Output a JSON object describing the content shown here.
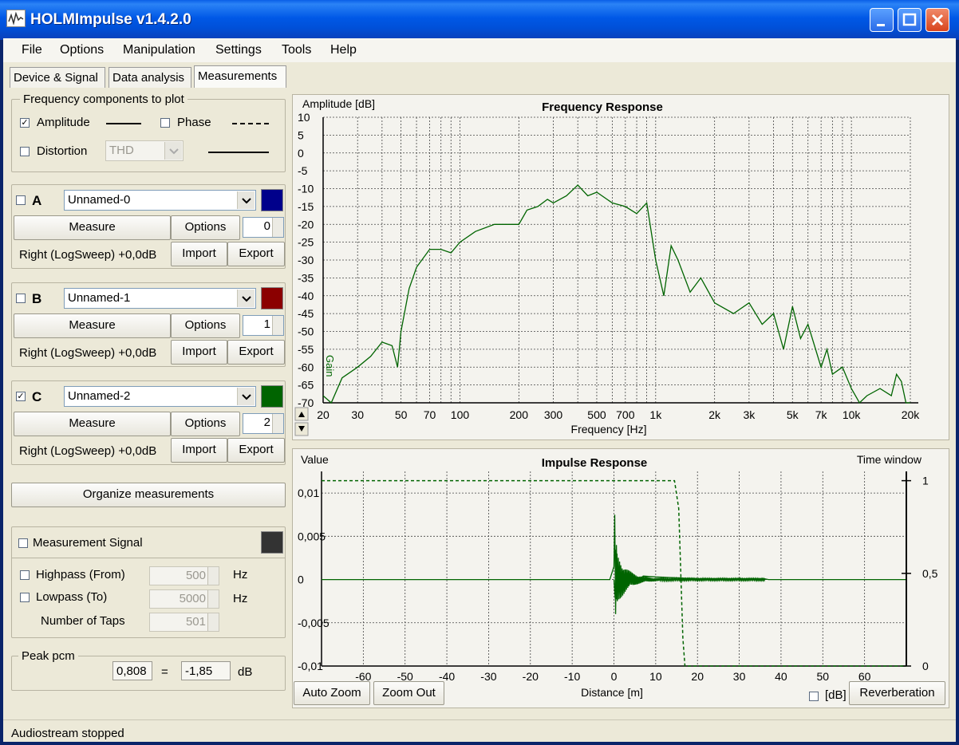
{
  "window": {
    "title": "HOLMImpulse  v1.4.2.0"
  },
  "menu": [
    "File",
    "Options",
    "Manipulation",
    "Settings",
    "Tools",
    "Help"
  ],
  "tabs": [
    "Device & Signal",
    "Data analysis",
    "Measurements"
  ],
  "components": {
    "title": "Frequency components to plot",
    "amplitude_label": "Amplitude",
    "phase_label": "Phase",
    "distortion_label": "Distortion",
    "distortion_type": "THD"
  },
  "measurements": [
    {
      "letter": "A",
      "name": "Unnamed-0",
      "checked": false,
      "color": "#00008b",
      "measure": "Measure",
      "options": "Options",
      "index": "0",
      "info": "Right (LogSweep) +0,0dB",
      "import": "Import",
      "export": "Export"
    },
    {
      "letter": "B",
      "name": "Unnamed-1",
      "checked": false,
      "color": "#8b0000",
      "measure": "Measure",
      "options": "Options",
      "index": "1",
      "info": "Right (LogSweep) +0,0dB",
      "import": "Import",
      "export": "Export"
    },
    {
      "letter": "C",
      "name": "Unnamed-2",
      "checked": true,
      "color": "#006400",
      "measure": "Measure",
      "options": "Options",
      "index": "2",
      "info": "Right (LogSweep) +0,0dB",
      "import": "Import",
      "export": "Export"
    }
  ],
  "organize_label": "Organize measurements",
  "signal": {
    "title": "Measurement Signal",
    "swatch_color": "#333333",
    "highpass_label": "Highpass (From)",
    "highpass_value": "500",
    "lowpass_label": "Lowpass (To)",
    "lowpass_value": "5000",
    "hz": "Hz",
    "taps_label": "Number of Taps",
    "taps_value": "501"
  },
  "peak": {
    "title": "Peak pcm",
    "pcm": "0,808",
    "equals": "=",
    "db_value": "-1,85",
    "db": "dB"
  },
  "freq_chart": {
    "title": "Frequency Response",
    "ylabel": "Amplitude [dB]",
    "xlabel": "Frequency [Hz]",
    "ytick_labels": [
      "10",
      "5",
      "0",
      "-5",
      "-10",
      "-15",
      "-20",
      "-25",
      "-30",
      "-35",
      "-40",
      "-45",
      "-50",
      "-55",
      "-60",
      "-65",
      "-70"
    ],
    "xtick_labels": [
      "20",
      "30",
      "50",
      "70",
      "100",
      "200",
      "300",
      "500",
      "700",
      "1k",
      "2k",
      "3k",
      "5k",
      "7k",
      "10k",
      "20k"
    ],
    "gain_label": "Gain",
    "series_color": "#006400"
  },
  "impulse_chart": {
    "title": "Impulse Response",
    "ylabel": "Value",
    "y2label": "Time window",
    "xlabel": "Distance [m]",
    "ytick_labels": [
      "0,01",
      "0,005",
      "0",
      "-0,005",
      "-0,01"
    ],
    "y2tick_labels": [
      "1",
      "0,5",
      "0"
    ],
    "xtick_labels": [
      "-60",
      "-50",
      "-40",
      "-30",
      "-20",
      "-10",
      "0",
      "10",
      "20",
      "30",
      "40",
      "50",
      "60"
    ],
    "auto_zoom": "Auto Zoom",
    "zoom_out": "Zoom Out",
    "db_label": "[dB]",
    "reverberation": "Reverberation"
  },
  "chart_data": [
    {
      "type": "line",
      "title": "Frequency Response",
      "xlabel": "Frequency [Hz]",
      "ylabel": "Amplitude [dB]",
      "xscale": "log",
      "xlim": [
        20,
        20000
      ],
      "ylim": [
        -70,
        10
      ],
      "grid": true,
      "series": [
        {
          "name": "Unnamed-2",
          "color": "#006400",
          "x": [
            20,
            22,
            25,
            30,
            35,
            40,
            45,
            48,
            50,
            55,
            60,
            70,
            80,
            90,
            100,
            120,
            150,
            170,
            200,
            220,
            250,
            280,
            300,
            350,
            400,
            450,
            500,
            600,
            700,
            800,
            900,
            1000,
            1100,
            1200,
            1300,
            1500,
            1700,
            2000,
            2500,
            3000,
            3500,
            4000,
            4500,
            5000,
            5500,
            6000,
            7000,
            7500,
            8000,
            9000,
            10000,
            11000,
            12000,
            14000,
            16000,
            17000,
            18000,
            19000,
            20000
          ],
          "y": [
            -68,
            -70,
            -63,
            -60,
            -57,
            -53,
            -54,
            -60,
            -50,
            -38,
            -32,
            -27,
            -27,
            -28,
            -25,
            -22,
            -20,
            -20,
            -20,
            -16,
            -15,
            -13,
            -14,
            -12,
            -9,
            -12,
            -11,
            -14,
            -15,
            -17,
            -14,
            -30,
            -40,
            -26,
            -30,
            -39,
            -35,
            -42,
            -45,
            -42,
            -48,
            -45,
            -55,
            -43,
            -52,
            -48,
            -60,
            -55,
            -62,
            -60,
            -66,
            -70,
            -68,
            -66,
            -68,
            -62,
            -64,
            -70,
            -70
          ]
        }
      ]
    },
    {
      "type": "line",
      "title": "Impulse Response",
      "xlabel": "Distance [m]",
      "ylabel": "Value",
      "y2label": "Time window",
      "xlim": [
        -70,
        70
      ],
      "ylim": [
        -0.01,
        0.0125
      ],
      "y2lim": [
        0,
        1.05
      ],
      "grid": true,
      "series": [
        {
          "name": "Unnamed-2",
          "color": "#006400",
          "x": [
            -70,
            -1,
            0,
            0.2,
            0.4,
            0.6,
            0.8,
            1.0,
            1.5,
            2,
            3,
            4,
            5,
            7,
            10,
            15,
            20,
            30,
            36,
            37,
            70
          ],
          "y": [
            0,
            0,
            0.0015,
            0.0075,
            -0.004,
            0.004,
            -0.0025,
            0.0015,
            -0.0015,
            0.001,
            -0.0008,
            0.0006,
            -0.0005,
            0.0004,
            0.0003,
            0.0002,
            0.0001,
            0.0001,
            0.0001,
            0,
            0
          ]
        },
        {
          "name": "Time window",
          "axis": "y2",
          "style": "dashed",
          "color": "#006400",
          "x": [
            -70,
            14.5,
            15.5,
            16.5,
            17,
            70
          ],
          "y": [
            1,
            1,
            0.85,
            0.15,
            0,
            0
          ]
        }
      ]
    }
  ],
  "status": {
    "text": "Audiostream stopped"
  }
}
